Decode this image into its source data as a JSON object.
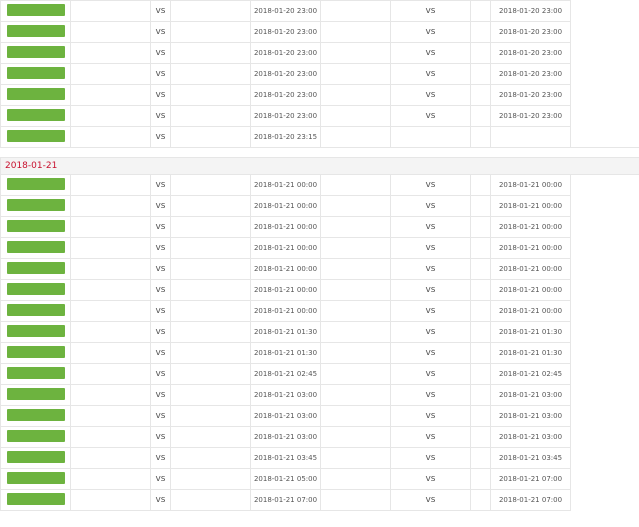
{
  "colors": {
    "league_tag": "#6db33f",
    "date_text": "#c8102e",
    "toggle_link": "#1f5fbf"
  },
  "groups": [
    {
      "date_bar": null,
      "rows": [
        {
          "left": {
            "league": "",
            "home": "",
            "vs": "vs",
            "away": "",
            "time": "2018-01-20 23:00"
          },
          "right": {
            "league": "",
            "home": "",
            "vs": "vs",
            "away": "",
            "time": "2018-01-20 23:00"
          }
        },
        {
          "left": {
            "league": "",
            "home": "",
            "vs": "vs",
            "away": "",
            "time": "2018-01-20 23:00"
          },
          "right": {
            "league": "",
            "home": "",
            "vs": "vs",
            "away": "",
            "time": "2018-01-20 23:00"
          }
        },
        {
          "left": {
            "league": "",
            "home": "",
            "vs": "vs",
            "away": "",
            "time": "2018-01-20 23:00"
          },
          "right": {
            "league": "",
            "home": "",
            "vs": "vs",
            "away": "",
            "time": "2018-01-20 23:00"
          }
        },
        {
          "left": {
            "league": "",
            "home": "",
            "vs": "vs",
            "away": "",
            "time": "2018-01-20 23:00"
          },
          "right": {
            "league": "",
            "home": "",
            "vs": "vs",
            "away": "",
            "time": "2018-01-20 23:00"
          }
        },
        {
          "left": {
            "league": "",
            "home": "",
            "vs": "vs",
            "away": "",
            "time": "2018-01-20 23:00"
          },
          "right": {
            "league": "",
            "home": "",
            "vs": "vs",
            "away": "",
            "time": "2018-01-20 23:00"
          }
        },
        {
          "left": {
            "league": "",
            "home": "",
            "vs": "vs",
            "away": "",
            "time": "2018-01-20 23:00"
          },
          "right": {
            "league": "",
            "home": "",
            "vs": "vs",
            "away": "",
            "time": "2018-01-20 23:00"
          }
        },
        {
          "left": {
            "league": "",
            "home": "",
            "vs": "vs",
            "away": "",
            "time": "2018-01-20 23:15"
          },
          "right": null
        }
      ]
    },
    {
      "date_bar": {
        "date": "2018-01-21",
        "count": "",
        "toggle": ""
      },
      "rows": [
        {
          "left": {
            "league": "",
            "home": "",
            "vs": "vs",
            "away": "",
            "time": "2018-01-21 00:00"
          },
          "right": {
            "league": "",
            "home": "",
            "vs": "vs",
            "away": "",
            "time": "2018-01-21 00:00"
          }
        },
        {
          "left": {
            "league": "",
            "home": "",
            "vs": "vs",
            "away": "",
            "time": "2018-01-21 00:00"
          },
          "right": {
            "league": "",
            "home": "",
            "vs": "vs",
            "away": "",
            "time": "2018-01-21 00:00"
          }
        },
        {
          "left": {
            "league": "",
            "home": "",
            "vs": "vs",
            "away": "",
            "time": "2018-01-21 00:00"
          },
          "right": {
            "league": "",
            "home": "",
            "vs": "vs",
            "away": "",
            "time": "2018-01-21 00:00"
          }
        },
        {
          "left": {
            "league": "",
            "home": "",
            "vs": "vs",
            "away": "",
            "time": "2018-01-21 00:00"
          },
          "right": {
            "league": "",
            "home": "",
            "vs": "vs",
            "away": "",
            "time": "2018-01-21 00:00"
          }
        },
        {
          "left": {
            "league": "",
            "home": "",
            "vs": "vs",
            "away": "",
            "time": "2018-01-21 00:00"
          },
          "right": {
            "league": "",
            "home": "",
            "vs": "vs",
            "away": "",
            "time": "2018-01-21 00:00"
          }
        },
        {
          "left": {
            "league": "",
            "home": "",
            "vs": "vs",
            "away": "",
            "time": "2018-01-21 00:00"
          },
          "right": {
            "league": "",
            "home": "",
            "vs": "vs",
            "away": "",
            "time": "2018-01-21 00:00"
          }
        },
        {
          "left": {
            "league": "",
            "home": "",
            "vs": "vs",
            "away": "",
            "time": "2018-01-21 00:00"
          },
          "right": {
            "league": "",
            "home": "",
            "vs": "vs",
            "away": "",
            "time": "2018-01-21 00:00"
          }
        },
        {
          "left": {
            "league": "",
            "home": "",
            "vs": "vs",
            "away": "",
            "time": "2018-01-21 01:30"
          },
          "right": {
            "league": "",
            "home": "",
            "vs": "vs",
            "away": "",
            "time": "2018-01-21 01:30"
          }
        },
        {
          "left": {
            "league": "",
            "home": "",
            "vs": "vs",
            "away": "",
            "time": "2018-01-21 01:30"
          },
          "right": {
            "league": "",
            "home": "",
            "vs": "vs",
            "away": "",
            "time": "2018-01-21 01:30"
          }
        },
        {
          "left": {
            "league": "",
            "home": "",
            "vs": "vs",
            "away": "",
            "time": "2018-01-21 02:45"
          },
          "right": {
            "league": "",
            "home": "",
            "vs": "vs",
            "away": "",
            "time": "2018-01-21 02:45"
          }
        },
        {
          "left": {
            "league": "",
            "home": "",
            "vs": "vs",
            "away": "",
            "time": "2018-01-21 03:00"
          },
          "right": {
            "league": "",
            "home": "",
            "vs": "vs",
            "away": "",
            "time": "2018-01-21 03:00"
          }
        },
        {
          "left": {
            "league": "",
            "home": "",
            "vs": "vs",
            "away": "",
            "time": "2018-01-21 03:00"
          },
          "right": {
            "league": "",
            "home": "",
            "vs": "vs",
            "away": "",
            "time": "2018-01-21 03:00"
          }
        },
        {
          "left": {
            "league": "",
            "home": "",
            "vs": "vs",
            "away": "",
            "time": "2018-01-21 03:00"
          },
          "right": {
            "league": "",
            "home": "",
            "vs": "vs",
            "away": "",
            "time": "2018-01-21 03:00"
          }
        },
        {
          "left": {
            "league": "",
            "home": "",
            "vs": "vs",
            "away": "",
            "time": "2018-01-21 03:45"
          },
          "right": {
            "league": "",
            "home": "",
            "vs": "vs",
            "away": "",
            "time": "2018-01-21 03:45"
          }
        },
        {
          "left": {
            "league": "",
            "home": "",
            "vs": "vs",
            "away": "",
            "time": "2018-01-21 05:00"
          },
          "right": {
            "league": "",
            "home": "",
            "vs": "vs",
            "away": "",
            "time": "2018-01-21 07:00"
          }
        },
        {
          "left": {
            "league": "",
            "home": "",
            "vs": "vs",
            "away": "",
            "time": "2018-01-21 07:00"
          },
          "right": {
            "league": "",
            "home": "",
            "vs": "vs",
            "away": "",
            "time": "2018-01-21 07:00"
          }
        }
      ]
    }
  ]
}
